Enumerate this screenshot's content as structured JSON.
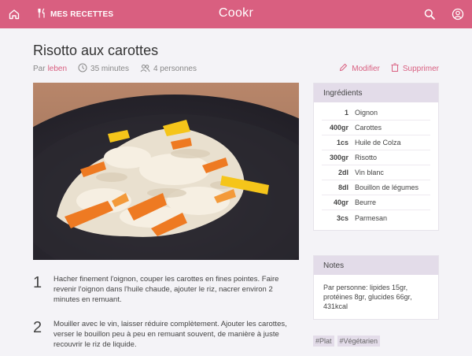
{
  "header": {
    "brand": "Cookr",
    "nav_label": "MES RECETTES"
  },
  "recipe": {
    "title": "Risotto aux carottes",
    "author_prefix": "Par",
    "author": "leben",
    "duration": "35 minutes",
    "servings": "4 personnes",
    "edit_label": "Modifier",
    "delete_label": "Supprimer"
  },
  "ingredients": {
    "title": "Ingrédients",
    "items": [
      {
        "qty": "1",
        "name": "Oignon"
      },
      {
        "qty": "400gr",
        "name": "Carottes"
      },
      {
        "qty": "1cs",
        "name": "Huile de Colza"
      },
      {
        "qty": "300gr",
        "name": "Risotto"
      },
      {
        "qty": "2dl",
        "name": "Vin blanc"
      },
      {
        "qty": "8dl",
        "name": "Bouillon de légumes"
      },
      {
        "qty": "40gr",
        "name": "Beurre"
      },
      {
        "qty": "3cs",
        "name": "Parmesan"
      }
    ]
  },
  "notes": {
    "title": "Notes",
    "text": "Par personne: lipides 15gr, protéines 8gr, glucides 66gr, 431kcal"
  },
  "steps": [
    {
      "num": "1",
      "text": "Hacher finement l'oignon, couper les carottes en fines pointes. Faire revenir l'oignon dans l'huile chaude, ajouter le riz, nacrer environ 2 minutes en remuant."
    },
    {
      "num": "2",
      "text": "Mouiller avec le vin, laisser réduire complètement. Ajouter les carottes, verser le bouillon peu à peu en remuant souvent, de manière à juste recouvrir le riz de liquide."
    }
  ],
  "tags": [
    "#Plat",
    "#Végétarien"
  ],
  "colors": {
    "accent": "#d95f80",
    "card_header": "#e3dce9",
    "background": "#f4f3f7"
  }
}
